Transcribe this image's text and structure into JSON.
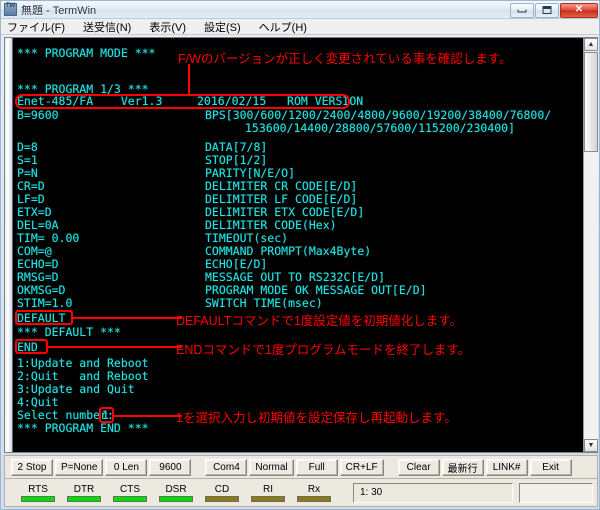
{
  "window": {
    "title": "無題 - TermWin",
    "icon": "termwin-app-icon",
    "caption": {
      "minimize": "minimize",
      "restore": "restore",
      "close": "✕"
    }
  },
  "menubar": {
    "items": [
      {
        "label": "ファイル(F)",
        "name": "menu-file"
      },
      {
        "label": "送受信(N)",
        "name": "menu-transfer"
      },
      {
        "label": "表示(V)",
        "name": "menu-view"
      },
      {
        "label": "設定(S)",
        "name": "menu-settings"
      },
      {
        "label": "ヘルプ(H)",
        "name": "menu-help"
      }
    ]
  },
  "terminal": {
    "fg_color": "#22e3e3",
    "bg_color": "#000000",
    "lines": {
      "program_mode": "*** PROGRAM MODE ***",
      "program_page": "*** PROGRAM 1/3 ***",
      "version_line": "Enet-485/FA    Ver1.3     2016/02/15   ROM VERSION",
      "bps_value": "B=9600",
      "bps_label_1": "BPS[300/600/1200/2400/4800/9600/19200/38400/76800/",
      "bps_label_2": "153600/14400/28800/57600/115200/230400]",
      "data_value": "D=8",
      "data_label": "DATA[7/8]",
      "stop_value": "S=1",
      "stop_label": "STOP[1/2]",
      "parity_value": "P=N",
      "parity_label": "PARITY[N/E/O]",
      "cr_value": "CR=D",
      "cr_label": "DELIMITER CR CODE[E/D]",
      "lf_value": "LF=D",
      "lf_label": "DELIMITER LF CODE[E/D]",
      "etx_value": "ETX=D",
      "etx_label": "DELIMITER ETX CODE[E/D]",
      "del_value": "DEL=0A",
      "del_label": "DELIMITER CODE(Hex)",
      "tim_value": "TIM= 0.00",
      "tim_label": "TIMEOUT(sec)",
      "com_value": "COM=@",
      "com_label": "COMMAND PROMPT(Max4Byte)",
      "echo_value": "ECHO=D",
      "echo_label": "ECHO[E/D]",
      "rmsg_value": "RMSG=D",
      "rmsg_label": "MESSAGE OUT TO RS232C[E/D]",
      "okmsg_value": "OKMSG=D",
      "okmsg_label": "PROGRAM MODE OK MESSAGE OUT[E/D]",
      "stim_value": "STIM=1.0",
      "stim_label": "SWITCH TIME(msec)",
      "cmd_default": "DEFAULT",
      "default_echo": "*** DEFAULT ***",
      "cmd_end": "END",
      "menu_1": "1:Update and Reboot",
      "menu_2": "2:Quit   and Reboot",
      "menu_3": "3:Update and Quit",
      "menu_4": "4:Quit",
      "select_prompt": "Select number:",
      "select_value": "1",
      "program_end": "*** PROGRAM END ***"
    }
  },
  "annotations": {
    "color": "#ff0000",
    "firmware_version": "F/Wのバージョンが正しく変更されている事を確認します。",
    "default_command": "DEFAULTコマンドで1度設定値を初期値化します。",
    "end_command": "ENDコマンドで1度プログラムモードを終了します。",
    "select_one": "1を選択入力し初期値を設定保存し再起動します。"
  },
  "toolbar": {
    "buttons_left": [
      {
        "label": "2 Stop",
        "name": "stopbit-button"
      },
      {
        "label": "P=None",
        "name": "parity-button"
      },
      {
        "label": "0 Len",
        "name": "length-button"
      },
      {
        "label": "9600",
        "name": "baudrate-button"
      }
    ],
    "buttons_right": [
      {
        "label": "Com4",
        "name": "comport-button"
      },
      {
        "label": "Normal",
        "name": "mode-button"
      },
      {
        "label": "Full",
        "name": "duplex-button"
      },
      {
        "label": "CR+LF",
        "name": "newline-button"
      }
    ],
    "buttons_tail": [
      {
        "label": "Clear",
        "name": "clear-button"
      },
      {
        "label": "最新行",
        "name": "latest-line-button"
      },
      {
        "label": "LINK#",
        "name": "link-button"
      },
      {
        "label": "Exit",
        "name": "exit-button"
      }
    ]
  },
  "statusbar": {
    "leds": [
      {
        "label": "RTS",
        "state": "on"
      },
      {
        "label": "DTR",
        "state": "on"
      },
      {
        "label": "CTS",
        "state": "on"
      },
      {
        "label": "DSR",
        "state": "on"
      },
      {
        "label": "CD",
        "state": "off"
      },
      {
        "label": "RI",
        "state": "off"
      },
      {
        "label": "Rx",
        "state": "off"
      }
    ],
    "led_on_color": "#00e000",
    "led_off_color": "#8a7b16",
    "counter": "1: 30"
  }
}
